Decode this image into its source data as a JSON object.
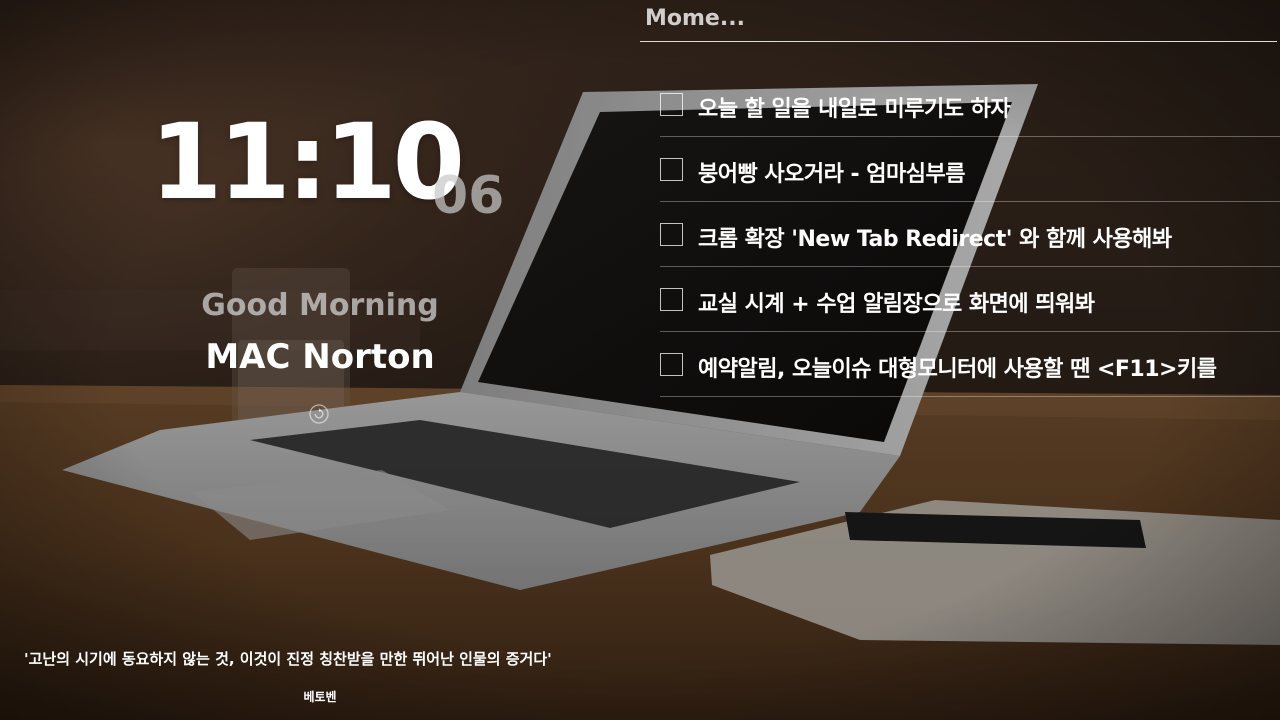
{
  "clock": {
    "time": "11:10",
    "seconds": "06"
  },
  "greeting": {
    "text": "Good Morning",
    "name": "MAC Norton"
  },
  "refresh_icon": "refresh-icon",
  "memo": {
    "title": "Mome...",
    "items": [
      {
        "text": "오늘 할 일을 내일로 미루기도 하자",
        "checked": false
      },
      {
        "text": "붕어빵 사오거라 - 엄마심부름",
        "checked": false
      },
      {
        "text": "크롬 확장 'New Tab Redirect' 와 함께 사용해봐",
        "checked": false
      },
      {
        "text": "교실 시계 + 수업 알림장으로 화면에 띄워봐",
        "checked": false
      },
      {
        "text": "예약알림, 오늘이슈 대형모니터에 사용할 땐 <F11>키를",
        "checked": false
      }
    ]
  },
  "quote": {
    "text": "'고난의 시기에 동요하지 않는 것, 이것이 진정 칭찬받을 만한 뛰어난 인물의 증거다'",
    "author": "베토벤"
  },
  "colors": {
    "text": "#ffffff",
    "seconds": "#c8c8c8",
    "greeting": "#d7d7d7"
  }
}
